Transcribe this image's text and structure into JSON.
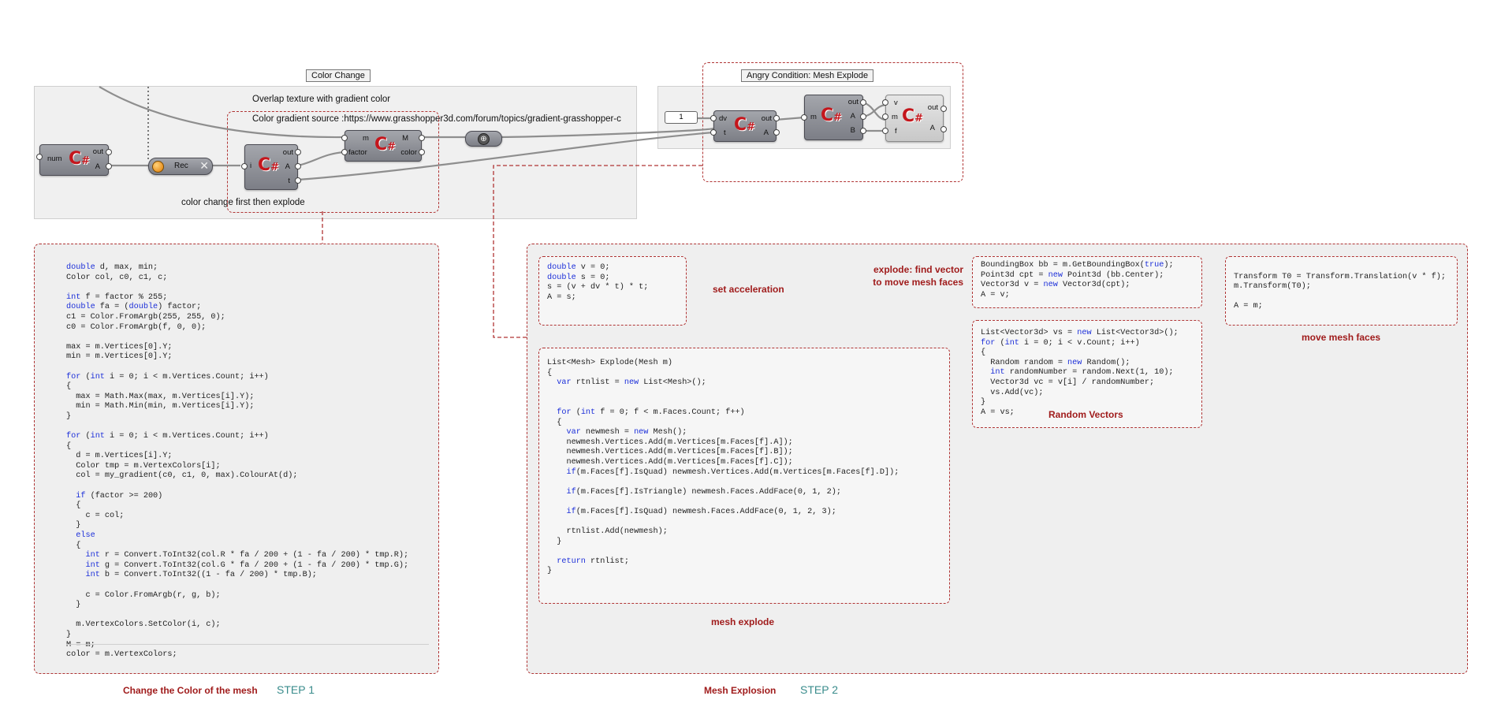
{
  "canvas": {
    "color_change_group": {
      "tag": "Color Change",
      "note_overlap": "Overlap texture with gradient color",
      "note_source": "Color gradient source :https://www.grasshopper3d.com/forum/topics/gradient-grasshopper-c",
      "note_order": "color change first then explode"
    },
    "explode_group": {
      "tag": "Angry Condition: Mesh Explode"
    },
    "components": {
      "num_comp": {
        "in": [
          "num"
        ],
        "out": [
          "out",
          "A"
        ]
      },
      "rec": {
        "label": "Rec"
      },
      "i_comp": {
        "in": [
          "i"
        ],
        "out": [
          "out",
          "A",
          "t"
        ]
      },
      "color_comp": {
        "in": [
          "m",
          "factor"
        ],
        "out": [
          "M",
          "color"
        ]
      },
      "slider": {
        "value": "1"
      },
      "dv_comp": {
        "in": [
          "dv",
          "t"
        ],
        "out": [
          "out",
          "A"
        ]
      },
      "m_comp": {
        "in": [
          "m"
        ],
        "out": [
          "out",
          "A",
          "B"
        ]
      },
      "v_comp": {
        "in": [
          "v",
          "m",
          "f"
        ],
        "out": [
          "out",
          "A"
        ]
      }
    },
    "icon_letter": "C",
    "icon_sub": "#"
  },
  "step1": {
    "code_lines": [
      "double d, max, min;",
      "Color col, c0, c1, c;",
      "",
      "int f = factor % 255;",
      "double fa = (double) factor;",
      "c1 = Color.FromArgb(255, 255, 0);",
      "c0 = Color.FromArgb(f, 0, 0);",
      "",
      "max = m.Vertices[0].Y;",
      "min = m.Vertices[0].Y;",
      "",
      "for (int i = 0; i < m.Vertices.Count; i++)",
      "{",
      "  max = Math.Max(max, m.Vertices[i].Y);",
      "  min = Math.Min(min, m.Vertices[i].Y);",
      "}",
      "",
      "for (int i = 0; i < m.Vertices.Count; i++)",
      "{",
      "  d = m.Vertices[i].Y;",
      "  Color tmp = m.VertexColors[i];",
      "  col = my_gradient(c0, c1, 0, max).ColourAt(d);",
      "",
      "  if (factor >= 200)",
      "  {",
      "    c = col;",
      "  }",
      "  else",
      "  {",
      "    int r = Convert.ToInt32(col.R * fa / 200 + (1 - fa / 200) * tmp.R);",
      "    int g = Convert.ToInt32(col.G * fa / 200 + (1 - fa / 200) * tmp.G);",
      "    int b = Convert.ToInt32((1 - fa / 200) * tmp.B);",
      "",
      "    c = Color.FromArgb(r, g, b);",
      "  }",
      "",
      "  m.VertexColors.SetColor(i, c);",
      "}",
      "M = m;",
      "color = m.VertexColors;"
    ],
    "label": "Change the Color of the mesh",
    "step": "STEP 1"
  },
  "step2": {
    "acceleration": {
      "code_lines": [
        "double v = 0;",
        "double s = 0;",
        "s = (v + dv * t) * t;",
        "A = s;"
      ],
      "label": "set acceleration"
    },
    "explode": {
      "code_lines": [
        "List<Mesh> Explode(Mesh m)",
        "{",
        "  var rtnlist = new List<Mesh>();",
        "",
        "",
        "  for (int f = 0; f < m.Faces.Count; f++)",
        "  {",
        "    var newmesh = new Mesh();",
        "    newmesh.Vertices.Add(m.Vertices[m.Faces[f].A]);",
        "    newmesh.Vertices.Add(m.Vertices[m.Faces[f].B]);",
        "    newmesh.Vertices.Add(m.Vertices[m.Faces[f].C]);",
        "    if(m.Faces[f].IsQuad) newmesh.Vertices.Add(m.Vertices[m.Faces[f].D]);",
        "",
        "    if(m.Faces[f].IsTriangle) newmesh.Faces.AddFace(0, 1, 2);",
        "",
        "    if(m.Faces[f].IsQuad) newmesh.Faces.AddFace(0, 1, 2, 3);",
        "",
        "    rtnlist.Add(newmesh);",
        "  }",
        "",
        "  return rtnlist;",
        "}"
      ],
      "label": "mesh explode"
    },
    "find_vector": {
      "label_line1": "explode: find vector",
      "label_line2": "to move mesh faces",
      "code_lines": [
        "BoundingBox bb = m.GetBoundingBox(true);",
        "Point3d cpt = new Point3d (bb.Center);",
        "Vector3d v = new Vector3d(cpt);",
        "A = v;"
      ]
    },
    "random_vectors": {
      "code_lines": [
        "List<Vector3d> vs = new List<Vector3d>();",
        "for (int i = 0; i < v.Count; i++)",
        "{",
        "  Random random = new Random();",
        "  int randomNumber = random.Next(1, 10);",
        "  Vector3d vc = v[i] / randomNumber;",
        "  vs.Add(vc);",
        "}",
        "A = vs;"
      ],
      "label": "Random Vectors"
    },
    "move_faces": {
      "code_lines": [
        "",
        "Transform T0 = Transform.Translation(v * f);",
        "m.Transform(T0);",
        "",
        "A = m;"
      ],
      "label": "move mesh faces"
    },
    "label": "Mesh Explosion",
    "step": "STEP 2"
  },
  "colors": {
    "accent_red": "#a01c1c",
    "dash_red": "#b03434",
    "keyword_blue": "#1c2fd9",
    "step_teal": "#3a8c8c"
  }
}
